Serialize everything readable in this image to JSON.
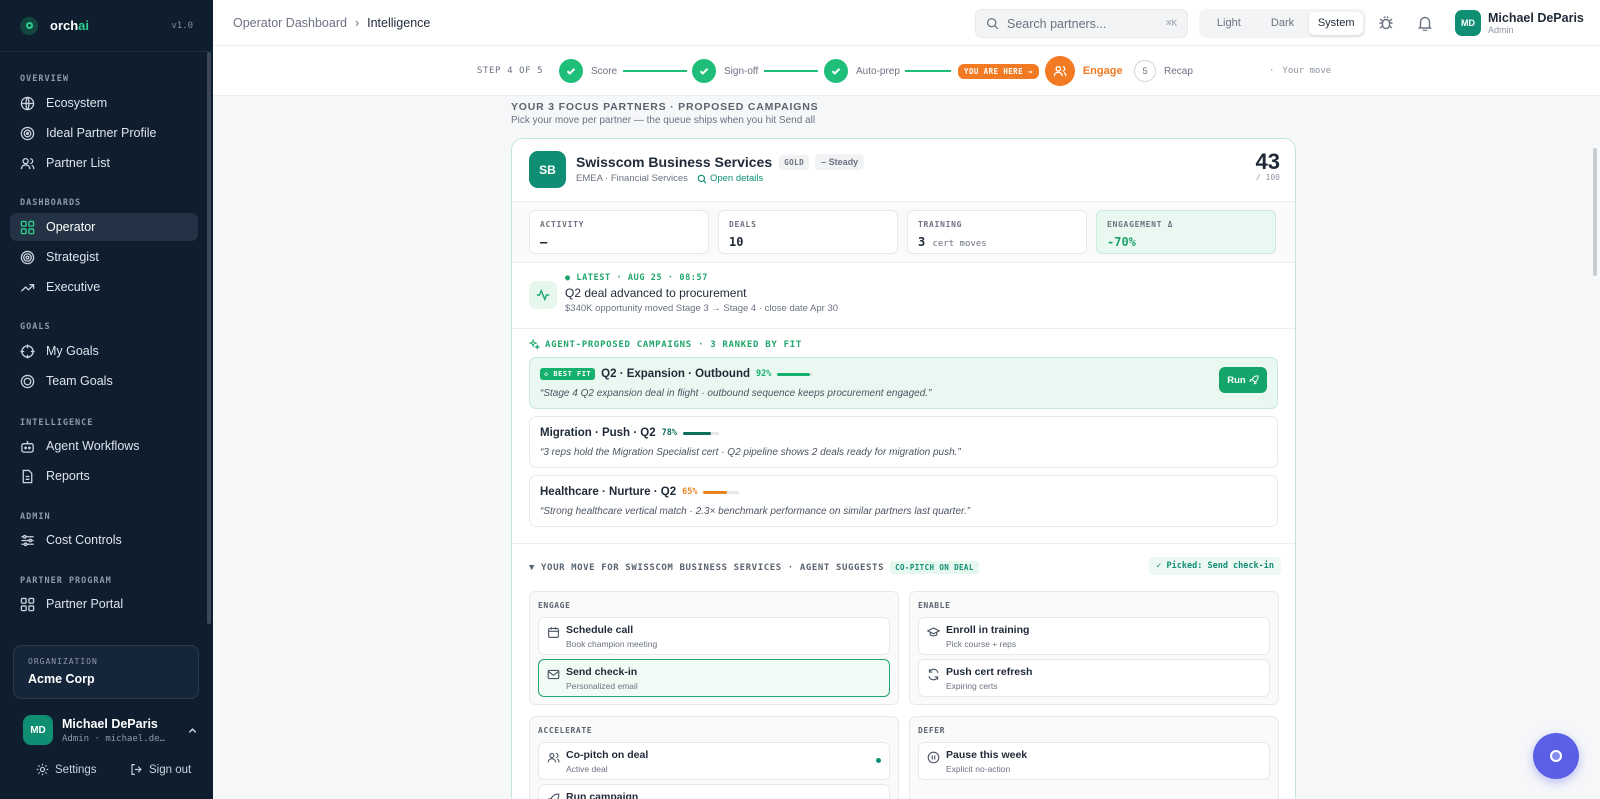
{
  "sidebar": {
    "logo": {
      "pre": "orch",
      "accent": "ai",
      "version": "v1.0"
    },
    "sections": {
      "overview": "OVERVIEW",
      "dashboards": "DASHBOARDS",
      "goals": "GOALS",
      "intelligence": "INTELLIGENCE",
      "admin": "ADMIN",
      "partner_program": "PARTNER PROGRAM"
    },
    "items": {
      "ecosystem": "Ecosystem",
      "ideal_partner_profile": "Ideal Partner Profile",
      "partner_list": "Partner List",
      "operator": "Operator",
      "strategist": "Strategist",
      "executive": "Executive",
      "my_goals": "My Goals",
      "team_goals": "Team Goals",
      "agent_workflows": "Agent Workflows",
      "reports": "Reports",
      "cost_controls": "Cost Controls",
      "partner_portal": "Partner Portal"
    },
    "org": {
      "label": "ORGANIZATION",
      "name": "Acme Corp"
    },
    "user": {
      "initials": "MD",
      "name": "Michael DeParis",
      "sub": "Admin · michael.de…"
    },
    "settings": "Settings",
    "sign_out": "Sign out"
  },
  "header": {
    "breadcrumb_parent": "Operator Dashboard",
    "breadcrumb_current": "Intelligence",
    "search_placeholder": "Search partners...",
    "search_shortcut": "⌘K",
    "theme": [
      "Light",
      "Dark",
      "System"
    ],
    "theme_selected": "System",
    "user": {
      "initials": "MD",
      "name": "Michael DeParis",
      "role": "Admin"
    }
  },
  "stepper": {
    "step_label": "STEP 4 OF 5",
    "steps": [
      "Score",
      "Sign-off",
      "Auto-prep",
      "Engage",
      "Recap"
    ],
    "you_are_here": "YOU ARE HERE →",
    "recap_number": "5",
    "right_note": "Your move"
  },
  "focus": {
    "heading": "YOUR 3 FOCUS PARTNERS · PROPOSED CAMPAIGNS",
    "sub": "Pick your move per partner — the queue ships when you hit Send all"
  },
  "partner": {
    "initials": "SB",
    "name": "Swisscom Business Services",
    "tier": "GOLD",
    "trend": "– Steady",
    "region": "EMEA · Financial Services",
    "open_details": "Open details",
    "score": "43",
    "score_of": "/ 100",
    "metrics": [
      {
        "label": "ACTIVITY",
        "value": "–",
        "unit": ""
      },
      {
        "label": "DEALS",
        "value": "10",
        "unit": ""
      },
      {
        "label": "TRAINING",
        "value": "3",
        "unit": "cert moves"
      },
      {
        "label": "ENGAGEMENT Δ",
        "value": "-70%",
        "unit": ""
      }
    ],
    "latest": {
      "tag": "● LATEST · AUG 25 · 08:57",
      "title": "Q2 deal advanced to procurement",
      "detail": "$340K opportunity moved Stage 3 → Stage 4 · close date Apr 30"
    },
    "campaigns_heading": "AGENT-PROPOSED CAMPAIGNS · 3 RANKED BY FIT",
    "campaigns": [
      {
        "badge": "◇ BEST FIT",
        "title": "Q2 · Expansion · Outbound",
        "fit": "92%",
        "fit_value": 0.92,
        "color": "#14b06c",
        "quote": "“Stage 4 Q2 expansion deal in flight · outbound sequence keeps procurement engaged.”",
        "action": "Run"
      },
      {
        "badge": "",
        "title": "Migration · Push · Q2",
        "fit": "78%",
        "fit_value": 0.78,
        "color": "#0f6e5c",
        "quote": "“3 reps hold the Migration Specialist cert · Q2 pipeline shows 2 deals ready for migration push.”",
        "action": ""
      },
      {
        "badge": "",
        "title": "Healthcare · Nurture · Q2",
        "fit": "65%",
        "fit_value": 0.65,
        "color": "#e8841f",
        "quote": "“Strong healthcare vertical match · 2.3× benchmark performance on similar partners last quarter.”",
        "action": ""
      }
    ],
    "your_move": {
      "heading": "▼ YOUR MOVE FOR SWISSCOM BUSINESS SERVICES · AGENT SUGGESTS",
      "suggest_tag": "CO-PITCH ON DEAL",
      "picked": "✓ Picked: Send check-in",
      "groups": {
        "engage": {
          "label": "ENGAGE",
          "options": [
            {
              "title": "Schedule call",
              "sub": "Book champion meeting"
            },
            {
              "title": "Send check-in",
              "sub": "Personalized email"
            }
          ]
        },
        "enable": {
          "label": "ENABLE",
          "options": [
            {
              "title": "Enroll in training",
              "sub": "Pick course + reps"
            },
            {
              "title": "Push cert refresh",
              "sub": "Expiring certs"
            }
          ]
        },
        "accelerate": {
          "label": "ACCELERATE",
          "options": [
            {
              "title": "Co-pitch on deal",
              "sub": "Active deal"
            },
            {
              "title": "Run campaign",
              "sub": ""
            }
          ]
        },
        "defer": {
          "label": "DEFER",
          "options": [
            {
              "title": "Pause this week",
              "sub": "Explicit no-action"
            }
          ]
        }
      }
    }
  },
  "colors": {
    "accent": "#0f8e74",
    "success": "#1fbf7a",
    "warning": "#f17a22",
    "sidebar": "#0f1e2e",
    "fab": "#5b5fe5"
  }
}
